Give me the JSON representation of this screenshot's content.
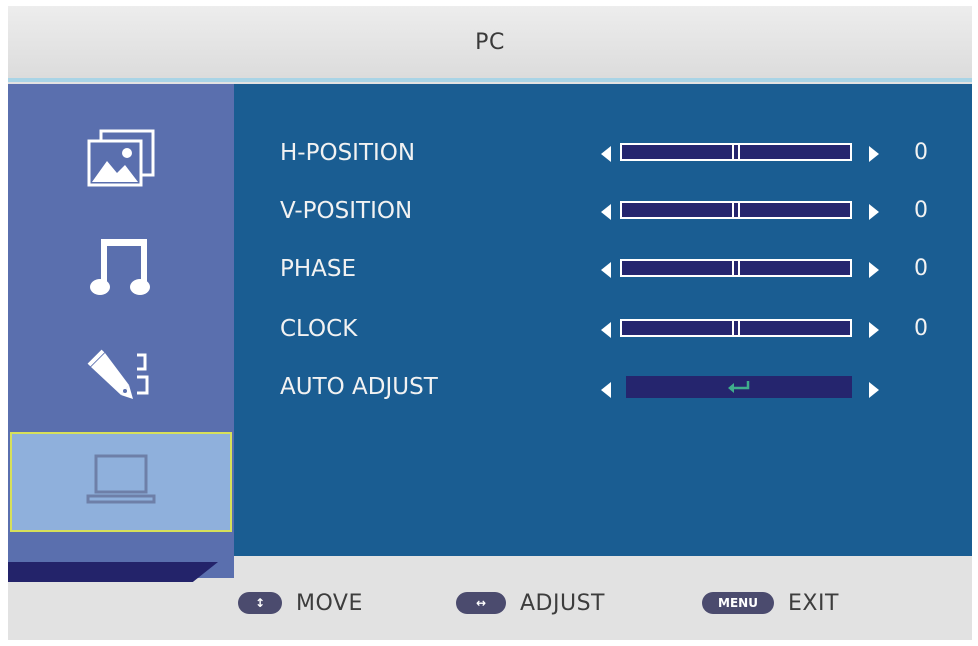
{
  "window": {
    "title": "PC"
  },
  "sidebar": {
    "items": [
      {
        "name": "picture",
        "icon": "picture-icon",
        "selected": false
      },
      {
        "name": "sound",
        "icon": "music-note-icon",
        "selected": false
      },
      {
        "name": "setup",
        "icon": "pen-setup-icon",
        "selected": false
      },
      {
        "name": "pc",
        "icon": "monitor-icon",
        "selected": true
      }
    ]
  },
  "settings": [
    {
      "label": "H-POSITION",
      "value": "0",
      "level": 0.5
    },
    {
      "label": "V-POSITION",
      "value": "0",
      "level": 0.5
    },
    {
      "label": "PHASE",
      "value": "0",
      "level": 0.5
    },
    {
      "label": "CLOCK",
      "value": "0",
      "level": 0.5
    }
  ],
  "auto_adjust": {
    "label": "AUTO ADJUST",
    "icon": "enter-icon"
  },
  "footer": {
    "move": {
      "badge": "↕",
      "label": "MOVE"
    },
    "adjust": {
      "badge": "↔",
      "label": "ADJUST"
    },
    "exit": {
      "badge": "MENU",
      "label": "EXIT"
    }
  },
  "colors": {
    "panel": "#1a5d92",
    "sidebar": "#5a6fae",
    "selected": "#8fb0dc",
    "selected_border": "#d7e05a",
    "track": "#25256e",
    "accent_line": "#a9d4e6"
  }
}
